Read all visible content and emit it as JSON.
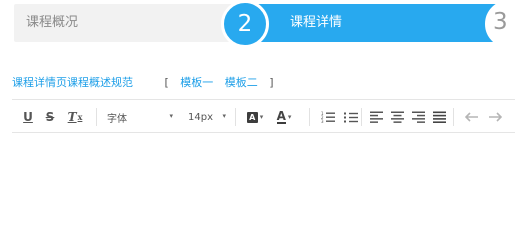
{
  "steps": {
    "step1_label": "课程概况",
    "step2_number": "2",
    "step2_label": "课程详情",
    "step3_number": "3"
  },
  "templates": {
    "guide_link": "课程详情页课程概述规范",
    "bracket_open": "[",
    "template_one": "模板一",
    "template_two": "模板二",
    "bracket_close": "]"
  },
  "toolbar": {
    "underline": "U",
    "strikethrough": "S",
    "clear_format": "T",
    "clear_format_sub": "x",
    "font_family": "字体",
    "font_size": "14px",
    "bg_color_glyph": "A",
    "font_color_glyph": "A",
    "caret": "▾"
  },
  "colors": {
    "accent": "#28a9ef",
    "link": "#1e9fe8",
    "inactive_step_bg": "#f2f2f2"
  },
  "icons": {
    "ordered_list": "ordered-list-icon",
    "unordered_list": "unordered-list-icon",
    "align_left": "align-left-icon",
    "align_center": "align-center-icon",
    "align_right": "align-right-icon",
    "align_justify": "align-justify-icon",
    "undo": "undo-icon",
    "redo": "redo-icon"
  }
}
